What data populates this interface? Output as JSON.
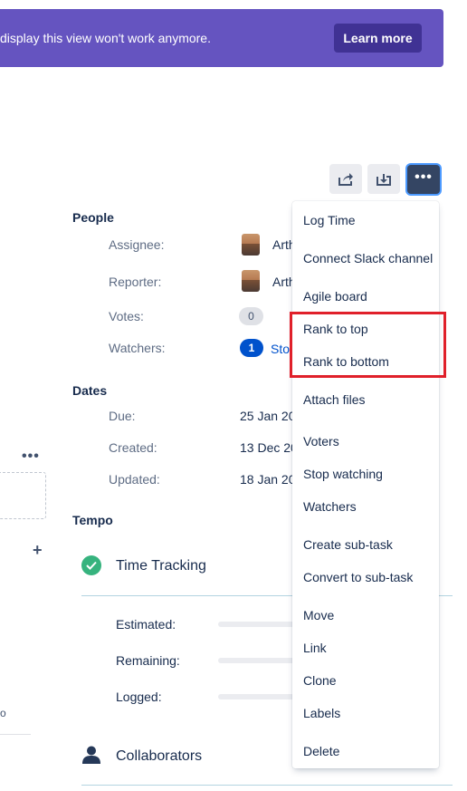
{
  "banner": {
    "message": "display this view won't work anymore.",
    "button_label": "Learn more"
  },
  "toolbar": {
    "share_icon": "share-icon",
    "export_icon": "export-icon",
    "more_label": "•••"
  },
  "people": {
    "title": "People",
    "assignee_label": "Assignee:",
    "assignee_value": "Arth",
    "reporter_label": "Reporter:",
    "reporter_value": "Arth",
    "votes_label": "Votes:",
    "votes_count": "0",
    "watchers_label": "Watchers:",
    "watchers_count": "1",
    "watchers_link": "Sto"
  },
  "dates": {
    "title": "Dates",
    "due_label": "Due:",
    "due_value": "25 Jan 20",
    "created_label": "Created:",
    "created_value": "13 Dec 20",
    "updated_label": "Updated:",
    "updated_value": "18 Jan 20"
  },
  "left_panel": {
    "dots": "•••",
    "plus": "+",
    "tick": "o"
  },
  "tempo": {
    "title": "Tempo",
    "time_tracking_title": "Time Tracking",
    "estimated_label": "Estimated:",
    "remaining_label": "Remaining:",
    "logged_label": "Logged:",
    "collaborators_title": "Collaborators"
  },
  "menu": {
    "items": [
      "Log Time",
      "Connect Slack channel",
      "Agile board",
      "Rank to top",
      "Rank to bottom",
      "Attach files",
      "Voters",
      "Stop watching",
      "Watchers",
      "Create sub-task",
      "Convert to sub-task",
      "Move",
      "Link",
      "Clone",
      "Labels",
      "Delete"
    ]
  },
  "colors": {
    "banner": "#6554c0",
    "banner_button": "#403294",
    "accent_blue": "#0052cc",
    "success_green": "#36b37e",
    "highlight_red": "#e0202a"
  }
}
